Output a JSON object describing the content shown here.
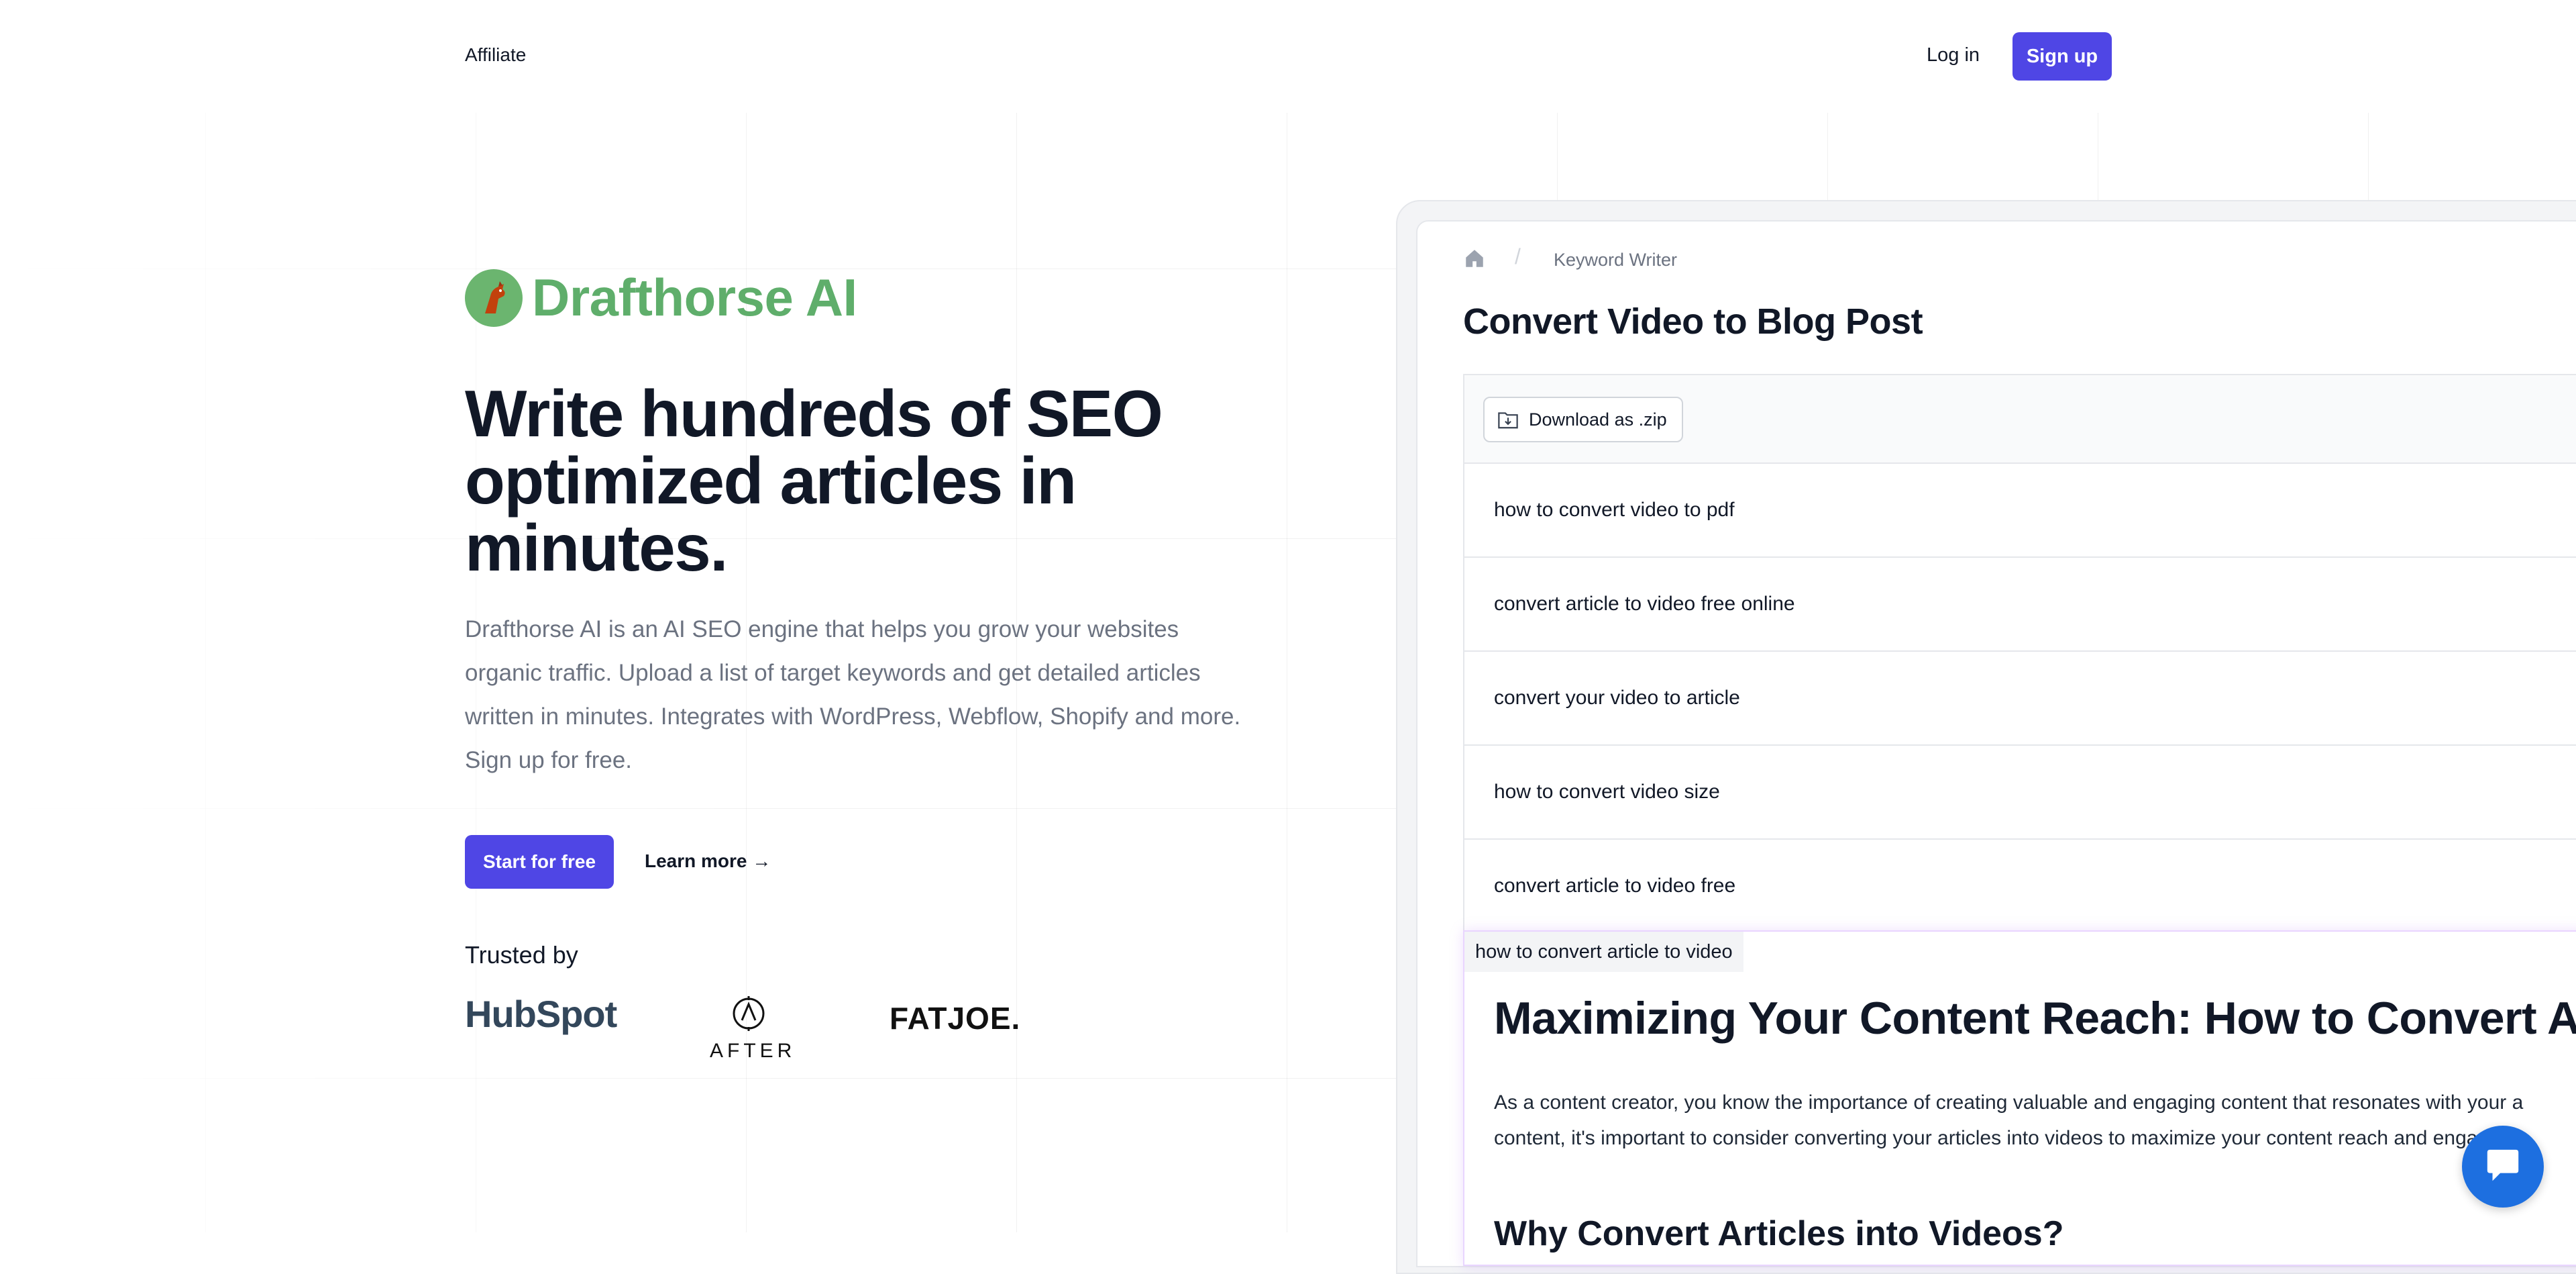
{
  "header": {
    "affiliate_label": "Affiliate",
    "login_label": "Log in",
    "signup_label": "Sign up"
  },
  "hero": {
    "brand_name": "Drafthorse AI",
    "headline_line1": "Write hundreds of SEO",
    "headline_line2": "optimized articles in",
    "headline_line3": "minutes.",
    "description": "Drafthorse AI is an AI SEO engine that helps you grow your websites organic traffic. Upload a list of target keywords and get detailed articles written in minutes. Integrates with WordPress, Webflow, Shopify and more. Sign up for free.",
    "start_label": "Start for free",
    "learn_label": "Learn more →",
    "trusted_label": "Trusted by",
    "logos": {
      "hubspot": "HubSpot",
      "after": "AFTER",
      "fatjoe": "FATJOE."
    }
  },
  "mockup": {
    "breadcrumb_label": "Keyword Writer",
    "title": "Convert Video to Blog Post",
    "download_label": "Download as .zip",
    "keywords": [
      "how to convert video to pdf",
      "convert article to video free online",
      "convert your video to article",
      "how to convert video size",
      "convert article to video free"
    ],
    "article": {
      "keyword_tag": "how to convert article to video",
      "title": "Maximizing Your Content Reach: How to Convert A",
      "para_line1": "As a content creator, you know the importance of creating valuable and engaging content that resonates with your a",
      "para_line2": "content, it's important to consider converting your articles into videos to maximize your content reach and engagem",
      "subheading": "Why Convert Articles into Videos?"
    }
  },
  "colors": {
    "accent": "#4f46e5",
    "brand_green": "#5fae6b",
    "chat_blue": "#1d6fe0",
    "hubspot_orange": "#ff7a59"
  },
  "icons": {
    "home": "home-icon",
    "download": "folder-download-icon",
    "chat": "chat-bubble-icon",
    "brand": "horse-logo-icon"
  }
}
